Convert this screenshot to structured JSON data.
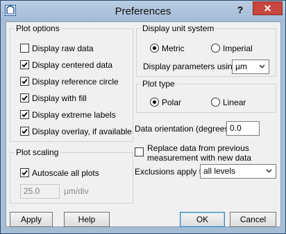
{
  "window": {
    "title": "Preferences",
    "help_glyph": "?",
    "close_glyph": "✕"
  },
  "plot_options": {
    "legend": "Plot options",
    "items": [
      {
        "label": "Display raw data",
        "checked": false
      },
      {
        "label": "Display centered data",
        "checked": true
      },
      {
        "label": "Display reference circle",
        "checked": true
      },
      {
        "label": "Display with fill",
        "checked": true
      },
      {
        "label": "Display extreme labels",
        "checked": true
      },
      {
        "label": "Display overlay, if available",
        "checked": true
      }
    ]
  },
  "plot_scaling": {
    "legend": "Plot scaling",
    "autoscale_label": "Autoscale all plots",
    "autoscale_checked": true,
    "scale_value": "25.0",
    "scale_unit": "µm/div"
  },
  "display_unit_system": {
    "legend": "Display unit system",
    "options": [
      {
        "label": "Metric",
        "selected": true
      },
      {
        "label": "Imperial",
        "selected": false
      }
    ],
    "params_label": "Display parameters using",
    "params_value": "µm"
  },
  "plot_type": {
    "legend": "Plot type",
    "options": [
      {
        "label": "Polar",
        "selected": true
      },
      {
        "label": "Linear",
        "selected": false
      }
    ]
  },
  "data_orientation": {
    "label": "Data orientation (degrees):",
    "value": "0.0"
  },
  "replace_data": {
    "line1": "Replace data from previous",
    "line2": "measurement with new data",
    "checked": false
  },
  "exclusions": {
    "label": "Exclusions apply to",
    "value": "all levels"
  },
  "buttons": {
    "apply": "Apply",
    "help": "Help",
    "ok": "OK",
    "cancel": "Cancel"
  },
  "colors": {
    "titlebar": "#a6bdd6",
    "close": "#c7463d",
    "default_button_border": "#3c7fb1"
  },
  "icons": {
    "app": "app-window-icon",
    "check": "check-mark",
    "dropdown": "chevron-down-icon"
  }
}
